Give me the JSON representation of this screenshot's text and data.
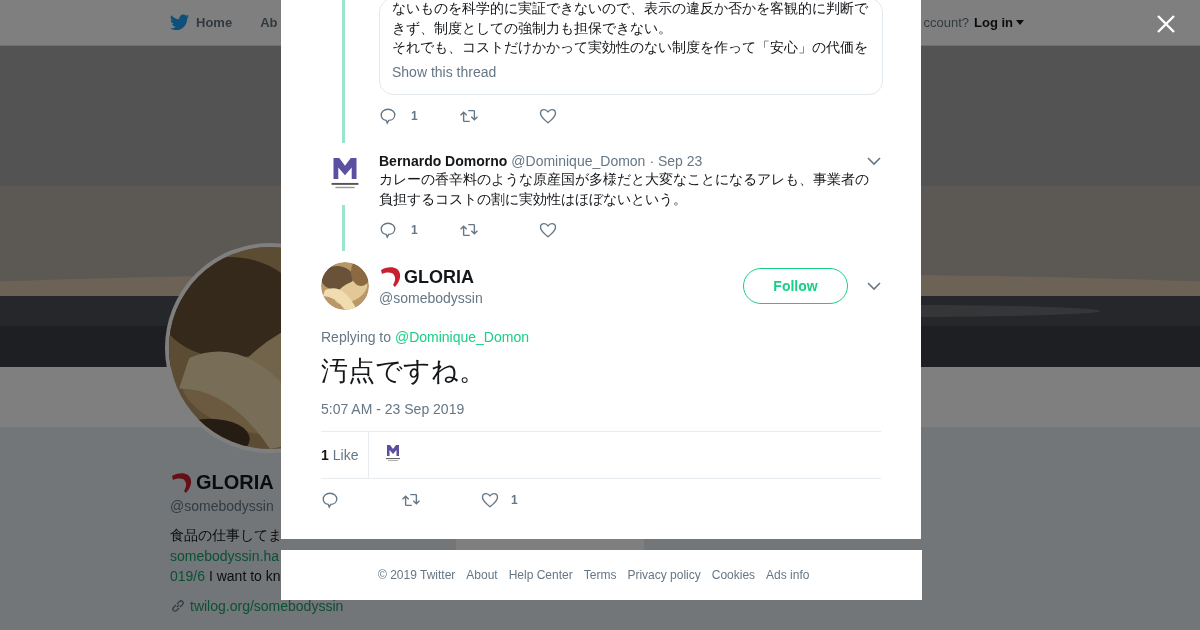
{
  "background_page": {
    "nav": {
      "items": [
        {
          "label": "Home"
        },
        {
          "label": "Ab"
        }
      ],
      "account_prompt": "ccount?",
      "login": "Log in"
    },
    "profile": {
      "name": "GLORIA",
      "handle": "@somebodyssin",
      "bio": "食品の仕事してま",
      "bio_link": "somebodyssin.ha",
      "bio_link_2": "019/6",
      "bio_text": "I want to kn",
      "website": "twilog.org/somebodyssin"
    }
  },
  "modal": {
    "parent_tweet": {
      "quote_paragraphs": [
        "ないものを科学的に実証できないので、表示の違反か否かを客観的に判断できず、制度としての強制力も担保できない。",
        "それでも、コストだけかかって実効性のない制度を作って「安心」の代価を"
      ],
      "show_thread": "Show this thread",
      "reply_count": "1"
    },
    "reply_tweet": {
      "name": "Bernardo Domorno",
      "handle": "@Dominique_Domon",
      "date": "· Sep 23",
      "text": "カレーの香辛料のような原産国が多様だと大変なことになるアレも、事業者の負担するコストの割に実効性はほぼないという。",
      "reply_count": "1"
    },
    "main_tweet": {
      "name": "GLORIA",
      "handle": "@somebodyssin",
      "follow": "Follow",
      "replying_label": "Replying to",
      "replying_handle": "@Dominique_Domon",
      "text": "汚点ですね。",
      "timestamp": "5:07 AM - 23 Sep 2019",
      "like_count": "1",
      "like_label": "Like",
      "like_action_count": "1"
    }
  },
  "footer": {
    "links": [
      "© 2019 Twitter",
      "About",
      "Help Center",
      "Terms",
      "Privacy policy",
      "Cookies",
      "Ads info"
    ]
  }
}
